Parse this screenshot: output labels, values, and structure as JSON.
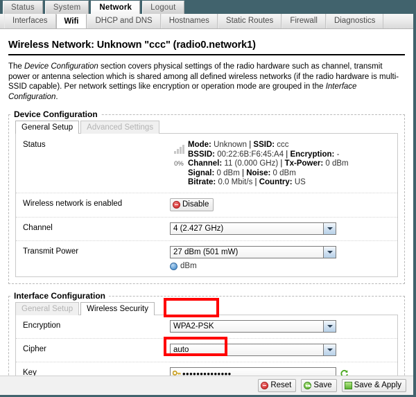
{
  "topnav": {
    "tabs": [
      {
        "label": "Status",
        "active": false
      },
      {
        "label": "System",
        "active": false
      },
      {
        "label": "Network",
        "active": true
      },
      {
        "label": "Logout",
        "active": false
      }
    ]
  },
  "subnav": {
    "tabs": [
      {
        "label": "Interfaces",
        "active": false
      },
      {
        "label": "Wifi",
        "active": true
      },
      {
        "label": "DHCP and DNS",
        "active": false
      },
      {
        "label": "Hostnames",
        "active": false
      },
      {
        "label": "Static Routes",
        "active": false
      },
      {
        "label": "Firewall",
        "active": false
      },
      {
        "label": "Diagnostics",
        "active": false
      }
    ]
  },
  "page": {
    "title": "Wireless Network: Unknown \"ccc\" (radio0.network1)",
    "description_part1": "The ",
    "description_em1": "Device Configuration",
    "description_part2": " section covers physical settings of the radio hardware such as channel, transmit power or antenna selection which is shared among all defined wireless networks (if the radio hardware is multi-SSID capable). Per network settings like encryption or operation mode are grouped in the ",
    "description_em2": "Interface Configuration",
    "description_part3": "."
  },
  "device_config": {
    "legend": "Device Configuration",
    "tabs": [
      {
        "label": "General Setup",
        "active": true
      },
      {
        "label": "Advanced Settings",
        "active": false
      }
    ],
    "status": {
      "label": "Status",
      "signal_percent": "0%",
      "signal_icon": "signal-bars-icon",
      "lines": [
        {
          "pairs": [
            {
              "k": "Mode:",
              "v": "Unknown"
            },
            {
              "k": "SSID:",
              "v": "ccc"
            }
          ]
        },
        {
          "pairs": [
            {
              "k": "BSSID:",
              "v": "00:22:6B:F6:45:A4"
            },
            {
              "k": "Encryption:",
              "v": "-"
            }
          ]
        },
        {
          "pairs": [
            {
              "k": "Channel:",
              "v": "11 (0.000 GHz)"
            },
            {
              "k": "Tx-Power:",
              "v": "0 dBm"
            }
          ]
        },
        {
          "pairs": [
            {
              "k": "Signal:",
              "v": "0 dBm"
            },
            {
              "k": "Noise:",
              "v": "0 dBm"
            }
          ]
        },
        {
          "pairs": [
            {
              "k": "Bitrate:",
              "v": "0.0 Mbit/s"
            },
            {
              "k": "Country:",
              "v": "US"
            }
          ]
        }
      ]
    },
    "enabled_row": {
      "label": "Wireless network is enabled",
      "button_label": "Disable",
      "button_icon": "disable-icon"
    },
    "channel_row": {
      "label": "Channel",
      "value": "4 (2.427 GHz)"
    },
    "txpower_row": {
      "label": "Transmit Power",
      "value": "27 dBm (501 mW)",
      "help_text": "dBm",
      "help_icon": "info-icon"
    }
  },
  "interface_config": {
    "legend": "Interface Configuration",
    "tabs": [
      {
        "label": "General Setup",
        "active": false
      },
      {
        "label": "Wireless Security",
        "active": true
      }
    ],
    "encryption_row": {
      "label": "Encryption",
      "value": "WPA2-PSK"
    },
    "cipher_row": {
      "label": "Cipher",
      "value": "auto"
    },
    "key_row": {
      "label": "Key",
      "value": "••••••••••••••",
      "key_icon": "key-icon",
      "reveal_icon": "reload-icon"
    }
  },
  "footer": {
    "buttons": [
      {
        "label": "Reset",
        "icon": "reset-icon"
      },
      {
        "label": "Save",
        "icon": "save-icon"
      },
      {
        "label": "Save & Apply",
        "icon": "save-apply-icon"
      }
    ]
  },
  "colors": {
    "nav_background": "#41636d",
    "annotation_red": "#ff0000",
    "accent_green": "#5cb233",
    "accent_red": "#d83a3a"
  }
}
